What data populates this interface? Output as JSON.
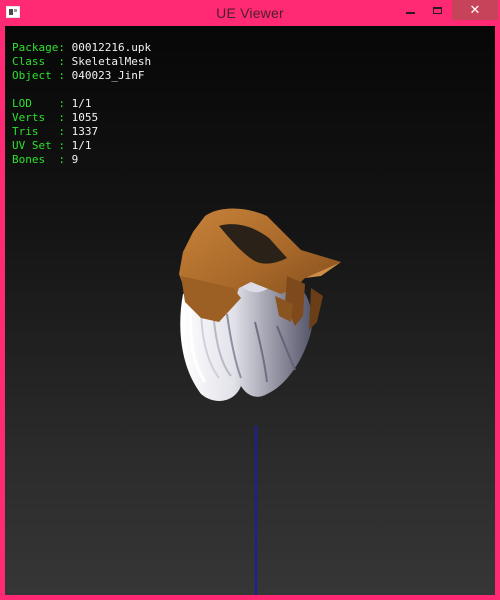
{
  "window": {
    "title": "UE Viewer",
    "close_glyph": "✕",
    "icons": [
      "app-icon",
      "minimize-icon",
      "maximize-icon",
      "close-icon"
    ]
  },
  "info": {
    "package_label": "Package:",
    "package_value": "00012216.upk",
    "class_label": "Class  :",
    "class_value": "SkeletalMesh",
    "object_label": "Object :",
    "object_value": "040023_JinF",
    "lod_label": "LOD    :",
    "lod_value": "1/1",
    "verts_label": "Verts  :",
    "verts_value": "1055",
    "tris_label": "Tris   :",
    "tris_value": "1337",
    "uvset_label": "UV Set :",
    "uvset_value": "1/1",
    "bones_label": "Bones  :",
    "bones_value": "9"
  },
  "colors": {
    "titlebar": "#ff2a73",
    "close_button": "#c7435a",
    "info_key": "#2ee02e",
    "info_value": "#f2f2f2",
    "axis": "#1c1ca8",
    "hat": "#b8732e",
    "hair": "#e6e6ee"
  }
}
